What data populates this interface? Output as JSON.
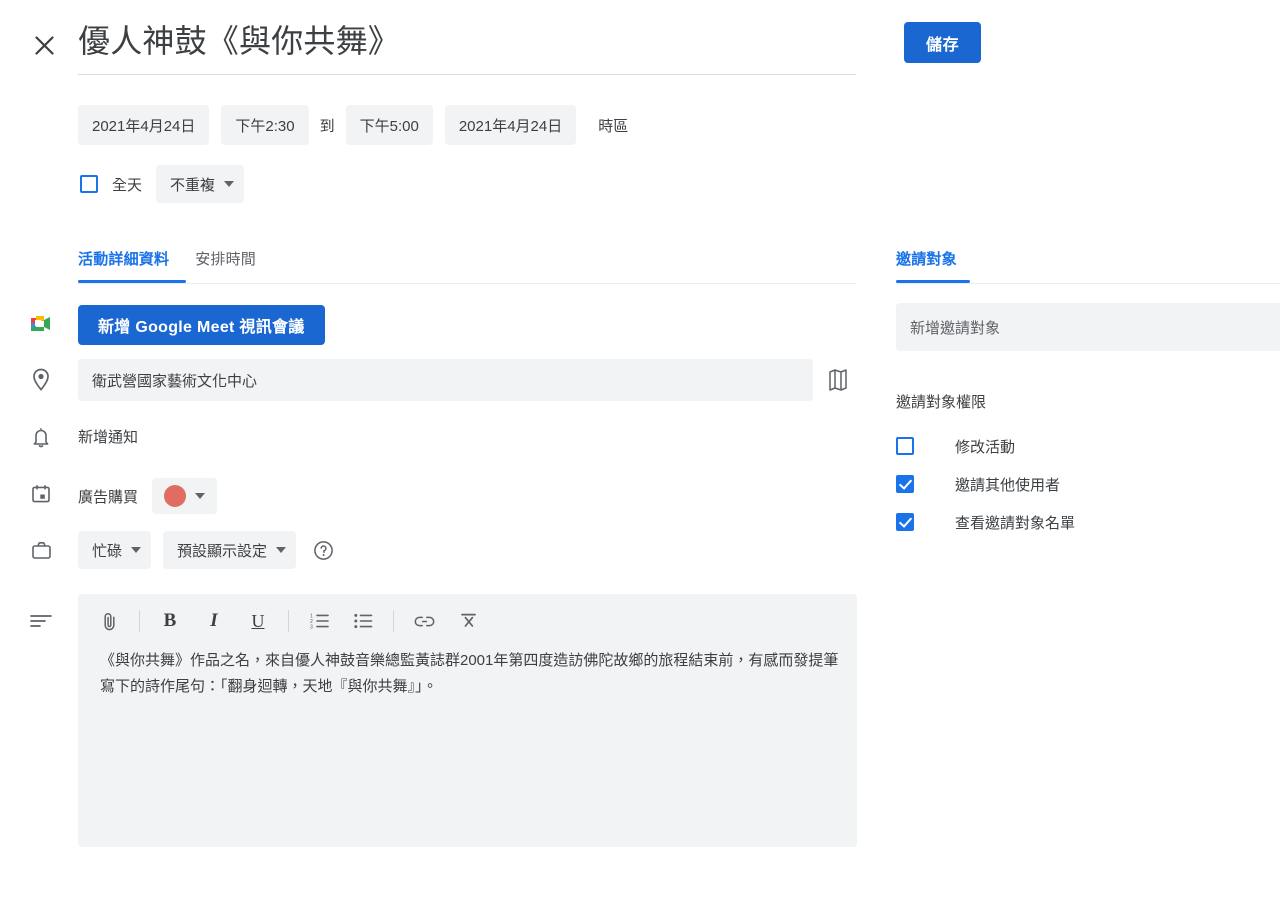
{
  "header": {
    "close_icon": "close-icon",
    "title": "優人神鼓《與你共舞》",
    "save_label": "儲存"
  },
  "schedule": {
    "start_date": "2021年4月24日",
    "start_time": "下午2:30",
    "to_label": "到",
    "end_time": "下午5:00",
    "end_date": "2021年4月24日",
    "timezone_label": "時區",
    "all_day_label": "全天",
    "all_day_checked": false,
    "repeat_label": "不重複"
  },
  "tabs": [
    {
      "label": "活動詳細資料",
      "active": true
    },
    {
      "label": "安排時間",
      "active": false
    }
  ],
  "details": {
    "meet_button_label": "新增 Google Meet 視訊會議",
    "meet_icon": "google-meet-icon",
    "location_icon": "location-pin-icon",
    "location_value": "衛武營國家藝術文化中心",
    "map_icon": "map-icon",
    "notification_icon": "bell-icon",
    "notification_label": "新增通知",
    "calendar_icon": "calendar-icon",
    "calendar_name": "廣告購買",
    "event_color": "#E06C62",
    "busy_icon": "briefcase-icon",
    "availability_label": "忙碌",
    "visibility_label": "預設顯示設定",
    "help_icon": "help-circle-icon",
    "description_icon": "description-lines-icon"
  },
  "editor_toolbar": [
    {
      "name": "attach-icon",
      "glyph": "attach"
    },
    {
      "name": "bold-icon",
      "glyph": "B"
    },
    {
      "name": "italic-icon",
      "glyph": "I"
    },
    {
      "name": "underline-icon",
      "glyph": "U"
    },
    {
      "name": "numbered-list-icon",
      "glyph": "ol"
    },
    {
      "name": "bulleted-list-icon",
      "glyph": "ul"
    },
    {
      "name": "link-icon",
      "glyph": "link"
    },
    {
      "name": "clear-formatting-icon",
      "glyph": "clear"
    }
  ],
  "description": {
    "text": "《與你共舞》作品之名，來自優人神鼓音樂總監黃誌群2001年第四度造訪佛陀故鄉的旅程結束前，有感而發提筆寫下的詩作尾句：「翻身迴轉，天地『與你共舞』」。"
  },
  "guests": {
    "tab_label": "邀請對象",
    "input_placeholder": "新增邀請對象",
    "permissions_title": "邀請對象權限",
    "permissions": [
      {
        "label": "修改活動",
        "checked": false
      },
      {
        "label": "邀請其他使用者",
        "checked": true
      },
      {
        "label": "查看邀請對象名單",
        "checked": true
      }
    ]
  },
  "colors": {
    "accent": "#1a73e8",
    "save_button": "#1a67d2",
    "field_bg": "#f1f3f4",
    "text": "#3c4043",
    "muted_text": "#5f6368",
    "divider": "#e8eaed"
  }
}
